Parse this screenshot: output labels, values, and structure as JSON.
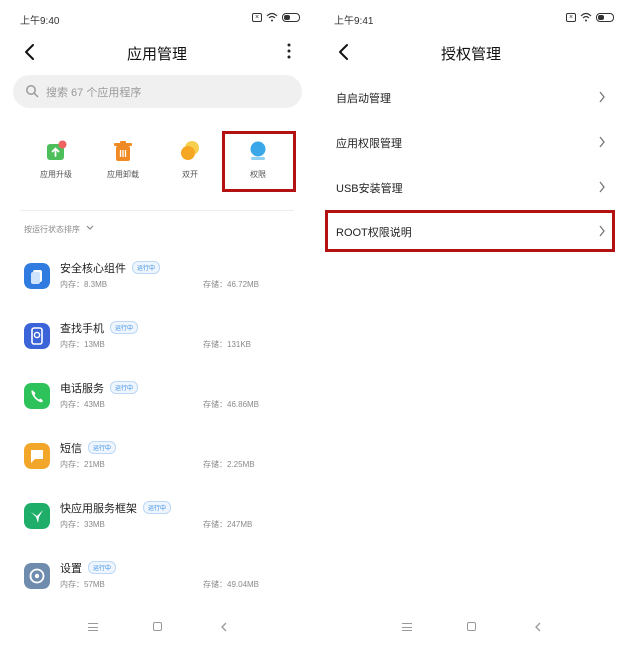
{
  "left": {
    "status": {
      "time": "上午9:40"
    },
    "title": "应用管理",
    "search": {
      "placeholder": "搜索 67 个应用程序"
    },
    "tools": [
      {
        "label": "应用升级",
        "icon": "app-upgrade-icon",
        "color": "#4cbf5a"
      },
      {
        "label": "应用卸载",
        "icon": "uninstall-icon",
        "color": "#f08a24"
      },
      {
        "label": "双开",
        "icon": "dual-apps-icon",
        "color": "#f5b324"
      },
      {
        "label": "权限",
        "icon": "permissions-icon",
        "color": "#3aa8e8"
      }
    ],
    "sort_label": "按运行状态排序",
    "apps": [
      {
        "name": "安全核心组件",
        "badge": "运行中",
        "memory": "内存：8.3MB",
        "storage": "存储：46.72MB",
        "icon": "security-core-icon",
        "color": "#2f7be0"
      },
      {
        "name": "查找手机",
        "badge": "运行中",
        "memory": "内存：13MB",
        "storage": "存储：131KB",
        "icon": "find-phone-icon",
        "color": "#3a64d8"
      },
      {
        "name": "电话服务",
        "badge": "运行中",
        "memory": "内存：43MB",
        "storage": "存储：46.86MB",
        "icon": "phone-icon",
        "color": "#2ec25a"
      },
      {
        "name": "短信",
        "badge": "运行中",
        "memory": "内存：21MB",
        "storage": "存储：2.25MB",
        "icon": "sms-icon",
        "color": "#f2a62a"
      },
      {
        "name": "快应用服务框架",
        "badge": "运行中",
        "memory": "内存：33MB",
        "storage": "存储：247MB",
        "icon": "quick-app-icon",
        "color": "#1fae6a"
      },
      {
        "name": "设置",
        "badge": "运行中",
        "memory": "内存：57MB",
        "storage": "存储：49.04MB",
        "icon": "settings-icon",
        "color": "#6f8cae"
      }
    ]
  },
  "right": {
    "status": {
      "time": "上午9:41"
    },
    "title": "授权管理",
    "items": [
      {
        "label": "自启动管理"
      },
      {
        "label": "应用权限管理"
      },
      {
        "label": "USB安装管理"
      },
      {
        "label": "ROOT权限说明"
      }
    ]
  },
  "colors": {
    "highlight": "#b41212",
    "badge": "#3a8ee6"
  }
}
